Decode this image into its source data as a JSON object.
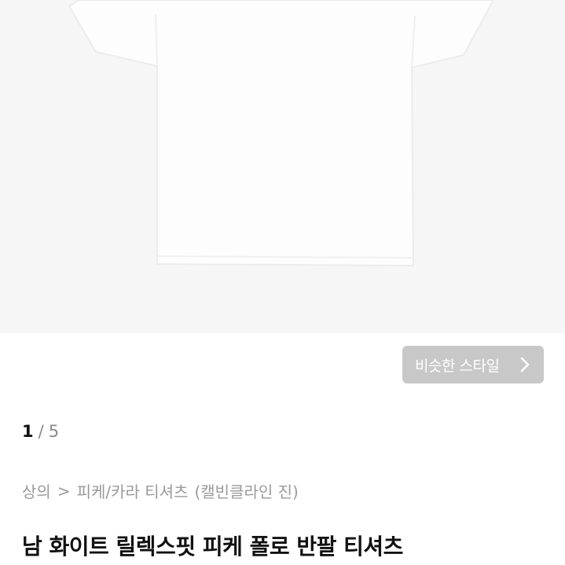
{
  "gallery": {
    "image_alt": "white t-shirt",
    "current_page": "1",
    "separator": "/",
    "total_pages": "5"
  },
  "similar_style": {
    "label": "비슷한 스타일",
    "icon": "chevron-right-icon"
  },
  "breadcrumb": {
    "category": "상의",
    "separator": ">",
    "subcategory": "피케/카라 티셔츠",
    "brand": "(캘빈클라인 진)"
  },
  "product": {
    "title": "남 화이트 릴렉스핏 피케 폴로 반팔 티셔츠"
  },
  "colors": {
    "background": "#ffffff",
    "image_bg": "#f6f6f6",
    "button_bg": "#c8c8c8",
    "text_dark": "#111111",
    "text_muted": "#9a9a9a"
  }
}
